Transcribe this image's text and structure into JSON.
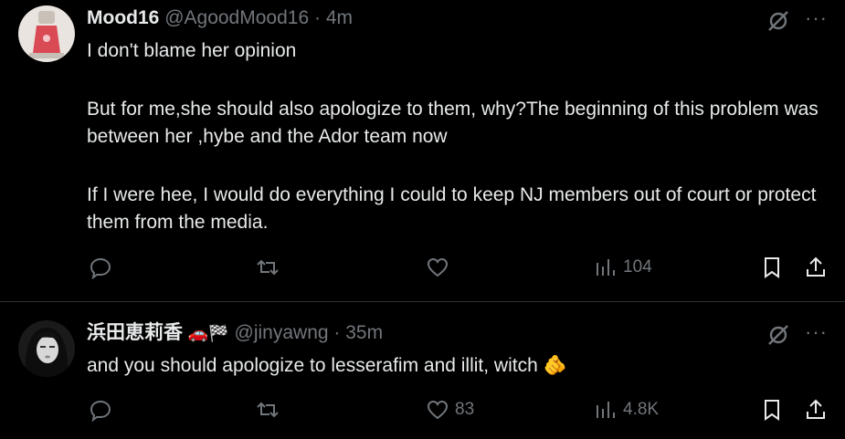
{
  "tweets": [
    {
      "display_name": "Mood16",
      "handle": "@AgoodMood16",
      "separator": "·",
      "time": "4m",
      "paragraphs": [
        "I don't blame her opinion",
        "But for me,she should also apologize to them, why?The beginning of this problem was between her ,hybe and the Ador team now",
        "If I were hee, I would do everything I could to keep NJ members out of court or protect them from the media."
      ],
      "replies": "",
      "retweets": "",
      "likes": "",
      "views": "104"
    },
    {
      "display_name": "浜田恵莉香",
      "emoji_badges": [
        "🚗",
        "🏁"
      ],
      "handle": "@jinyawng",
      "separator": "·",
      "time": "35m",
      "paragraphs": [
        "and you should apologize to lesserafim and illit, witch 🫵"
      ],
      "replies": "",
      "retweets": "",
      "likes": "83",
      "views": "4.8K"
    }
  ],
  "icons": {
    "reply": "reply-bubble-icon",
    "retweet": "retweet-icon",
    "like": "heart-icon",
    "views": "views-bar-icon",
    "bookmark": "bookmark-icon",
    "share": "share-icon",
    "mute": "grok-slash-icon",
    "more": "more-icon"
  },
  "colors": {
    "background": "#000000",
    "text": "#e7e9ea",
    "secondary": "#71767b",
    "divider": "#2f3336"
  }
}
